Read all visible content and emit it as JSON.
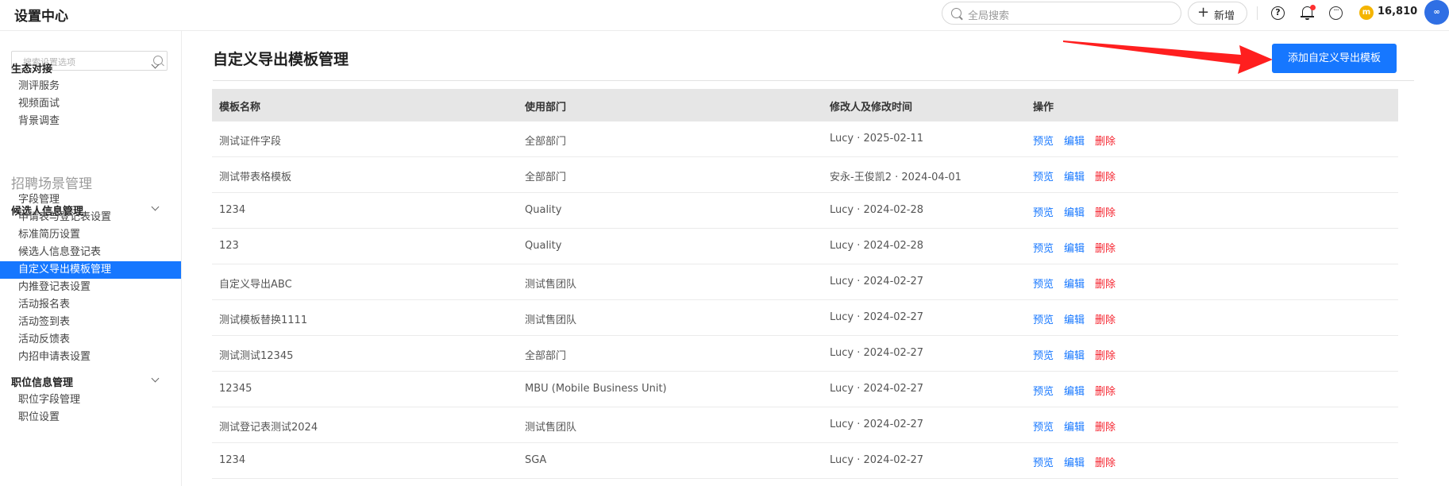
{
  "header": {
    "app_title": "设置中心",
    "search_placeholder": "全局搜索",
    "new_button": "新增",
    "coin_symbol": "m",
    "coin_count": "16,810",
    "avatar_text": "∞"
  },
  "sidebar": {
    "search_placeholder": "搜索设置选项",
    "top_group": {
      "title": "生态对接",
      "items": [
        "测评服务",
        "视频面试",
        "背景调查"
      ]
    },
    "section_title": "招聘场景管理",
    "candidate_group": {
      "title": "候选人信息管理",
      "items": [
        "字段管理",
        "申请表与登记表设置",
        "标准简历设置",
        "候选人信息登记表",
        "自定义导出模板管理",
        "内推登记表设置",
        "活动报名表",
        "活动签到表",
        "活动反馈表",
        "内招申请表设置"
      ],
      "active_index": 4
    },
    "position_group": {
      "title": "职位信息管理",
      "items": [
        "职位字段管理",
        "职位设置"
      ]
    }
  },
  "main": {
    "page_title": "自定义导出模板管理",
    "add_button": "添加自定义导出模板",
    "table": {
      "headers": [
        "模板名称",
        "使用部门",
        "修改人及修改时间",
        "操作"
      ],
      "actions": [
        "预览",
        "编辑",
        "删除"
      ],
      "rows": [
        {
          "name": "测试证件字段",
          "dept": "全部部门",
          "modified": "Lucy · 2025-02-11"
        },
        {
          "name": "测试带表格模板",
          "dept": "全部部门",
          "modified": "安永-王俊凯2 · 2024-04-01"
        },
        {
          "name": "1234",
          "dept": "Quality",
          "modified": "Lucy · 2024-02-28"
        },
        {
          "name": "123",
          "dept": "Quality",
          "modified": "Lucy · 2024-02-28"
        },
        {
          "name": "自定义导出ABC",
          "dept": "测试售团队",
          "modified": "Lucy · 2024-02-27"
        },
        {
          "name": "测试模板替换1111",
          "dept": "测试售团队",
          "modified": "Lucy · 2024-02-27"
        },
        {
          "name": "测试测试12345",
          "dept": "全部部门",
          "modified": "Lucy · 2024-02-27"
        },
        {
          "name": "12345",
          "dept": "MBU (Mobile Business Unit)",
          "modified": "Lucy · 2024-02-27"
        },
        {
          "name": "测试登记表测试2024",
          "dept": "测试售团队",
          "modified": "Lucy · 2024-02-27"
        },
        {
          "name": "1234",
          "dept": "SGA",
          "modified": "Lucy · 2024-02-27"
        }
      ]
    }
  },
  "colors": {
    "primary": "#1677ff",
    "danger": "#f5222d",
    "arrow": "#ff1f1f"
  }
}
